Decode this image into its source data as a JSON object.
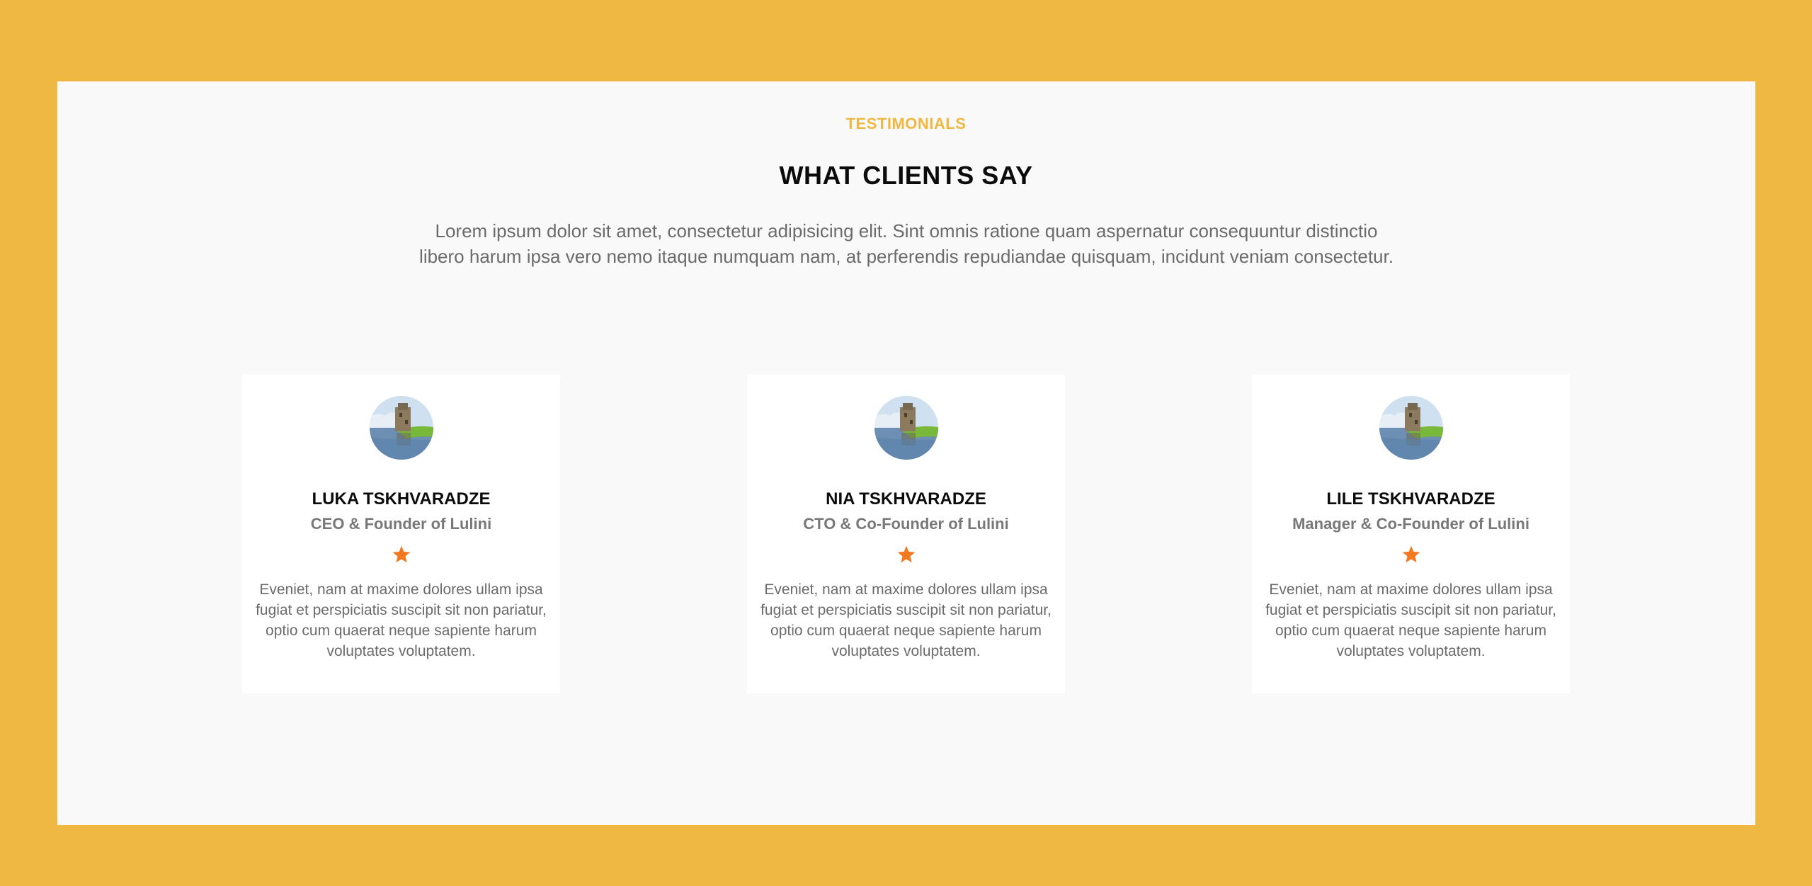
{
  "section": {
    "eyebrow": "TESTIMONIALS",
    "title": "WHAT CLIENTS SAY",
    "intro_line1": "Lorem ipsum dolor sit amet, consectetur adipisicing elit. Sint omnis ratione quam aspernatur consequuntur distinctio",
    "intro_line2": "libero harum ipsa vero nemo itaque numquam nam, at perferendis repudiandae quisquam, incidunt veniam consectetur."
  },
  "colors": {
    "page_background": "#efb843",
    "panel_background": "#f9f9f9",
    "accent": "#efb843",
    "star": "#f47820",
    "heading": "#0b0b0b",
    "body_text": "#6b6b6b"
  },
  "testimonials": [
    {
      "name": "LUKA TSKHVARADZE",
      "role": "CEO & Founder of Lulini",
      "rating_icon": "star-icon",
      "quote_lines": [
        "Eveniet, nam at maxime dolores ullam ipsa",
        "fugiat et perspiciatis suscipit sit non pariatur,",
        "optio cum quaerat neque sapiente harum",
        "voluptates voluptatem."
      ]
    },
    {
      "name": "NIA TSKHVARADZE",
      "role": "CTO & Co-Founder of Lulini",
      "rating_icon": "star-icon",
      "quote_lines": [
        "Eveniet, nam at maxime dolores ullam ipsa",
        "fugiat et perspiciatis suscipit sit non pariatur,",
        "optio cum quaerat neque sapiente harum",
        "voluptates voluptatem."
      ]
    },
    {
      "name": "LILE TSKHVARADZE",
      "role": "Manager & Co-Founder of Lulini",
      "rating_icon": "star-icon",
      "quote_lines": [
        "Eveniet, nam at maxime dolores ullam ipsa",
        "fugiat et perspiciatis suscipit sit non pariatur,",
        "optio cum quaerat neque sapiente harum",
        "voluptates voluptatem."
      ]
    }
  ]
}
